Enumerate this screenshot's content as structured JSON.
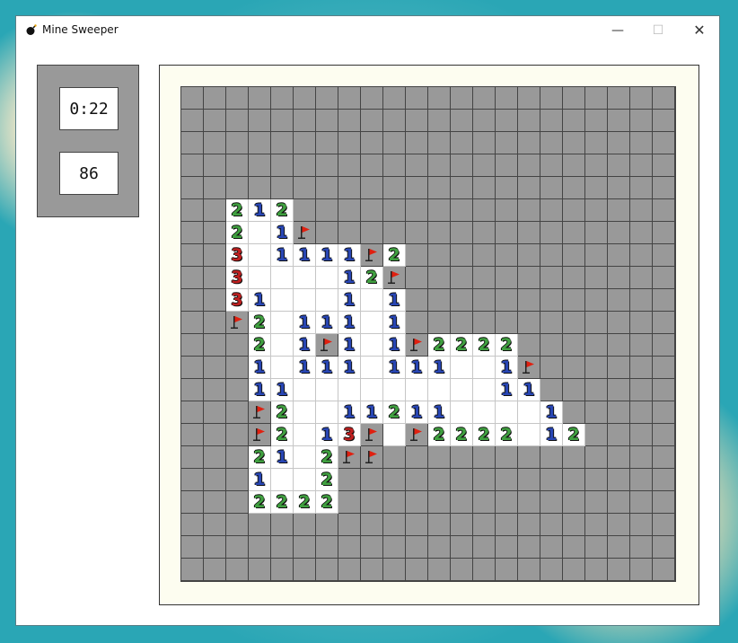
{
  "window": {
    "title": "Mine Sweeper"
  },
  "titlebar": {
    "minimize": "—",
    "maximize": "☐",
    "close": "✕"
  },
  "status": {
    "timer": "0:22",
    "mines_left": "86"
  },
  "colors": {
    "one": "#2846b4",
    "two": "#40a040",
    "three": "#c02020",
    "flag": "#e02010"
  },
  "board": {
    "rows": 22,
    "cols": 22,
    "cells": [
      "######################",
      "######################",
      "######################",
      "######################",
      "######################",
      "##212#################",
      "##2.1F################",
      "##3.1111F2############",
      "##3....12F############",
      "##31...1.1############",
      "##F2.111.1############",
      "###2.1F1.1F2222#######",
      "###1.111.111..1F######",
      "###11.........11######",
      "###F2..11211....1#####",
      "###F2.13F.F2222.12####",
      "###21.2FF#############",
      "###1..2###############",
      "###2222###############",
      "######################",
      "######################",
      "######################"
    ]
  }
}
